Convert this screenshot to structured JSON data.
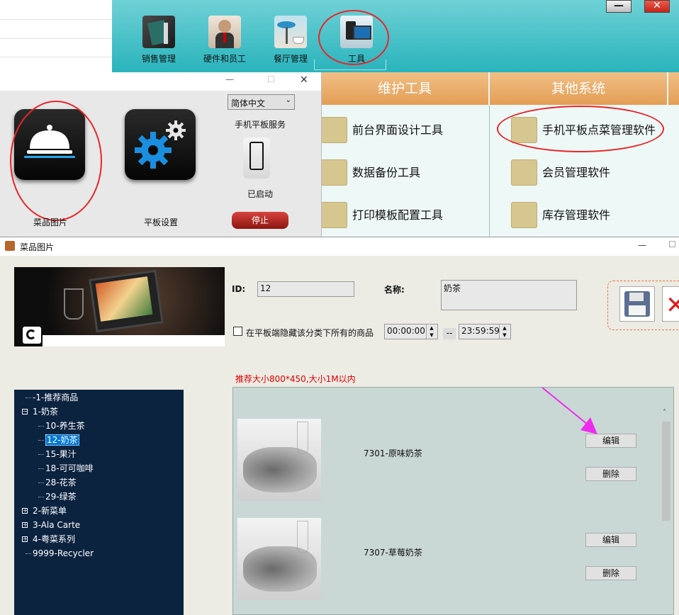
{
  "top_toolbar": {
    "items": [
      {
        "label": "销售管理"
      },
      {
        "label": "硬件和员工"
      },
      {
        "label": "餐厅管理"
      },
      {
        "label": "工具"
      }
    ],
    "minimize_glyph": "—",
    "close_glyph": "✕"
  },
  "maintenance_panel": {
    "headers": [
      "维护工具",
      "其他系统"
    ],
    "tools": [
      "前台界面设计工具",
      "数据备份工具",
      "打印模板配置工具"
    ],
    "systems": [
      "手机平板点菜管理软件",
      "会员管理软件",
      "库存管理软件"
    ]
  },
  "tablet_service_window": {
    "language_select": "简体中文",
    "service_label": "手机平板服务",
    "status": "已启动",
    "stop_button": "停止",
    "dish_image_label": "菜品图片",
    "tablet_settings_label": "平板设置",
    "titlebar_min": "—",
    "titlebar_max": "☐",
    "titlebar_close": "✕"
  },
  "dish_image_window": {
    "title": "菜品图片",
    "titlebar_min": "—",
    "titlebar_max": "☐",
    "id_label": "ID:",
    "id_value": "12",
    "name_label": "名称:",
    "name_value": "奶茶",
    "hide_checkbox_label": "在平板端隐藏该分类下所有的商品",
    "time_start": "00:00:00",
    "time_separator": "--",
    "time_end": "23:59:59",
    "size_hint": "推荐大小800*450,大小1M以内",
    "tree": [
      {
        "label": "-1-推荐商品",
        "level": 0,
        "toggle": ""
      },
      {
        "label": "1-奶茶",
        "level": 0,
        "toggle": "−"
      },
      {
        "label": "10-养生茶",
        "level": 1,
        "toggle": ""
      },
      {
        "label": "12-奶茶",
        "level": 1,
        "toggle": "",
        "selected": true
      },
      {
        "label": "15-果汁",
        "level": 1,
        "toggle": ""
      },
      {
        "label": "18-可可咖啡",
        "level": 1,
        "toggle": ""
      },
      {
        "label": "28-花茶",
        "level": 1,
        "toggle": ""
      },
      {
        "label": "29-绿茶",
        "level": 1,
        "toggle": ""
      },
      {
        "label": "2-新菜单",
        "level": 0,
        "toggle": "+"
      },
      {
        "label": "3-Ala Carte",
        "level": 0,
        "toggle": "+"
      },
      {
        "label": "4-粤菜系列",
        "level": 0,
        "toggle": "+"
      },
      {
        "label": "9999-Recycler",
        "level": 0,
        "toggle": ""
      }
    ],
    "dishes": [
      {
        "name": "7301-原味奶茶",
        "edit": "编辑",
        "delete": "删除"
      },
      {
        "name": "7307-草莓奶茶",
        "edit": "编辑",
        "delete": "删除"
      }
    ]
  },
  "colors": {
    "banner": "#2ab3bc",
    "maint_header": "#e6a35c",
    "annotation_red": "#e8262a",
    "arrow_magenta": "#ee2cee",
    "tree_bg": "#0c2340",
    "hint_red": "#e00000"
  }
}
